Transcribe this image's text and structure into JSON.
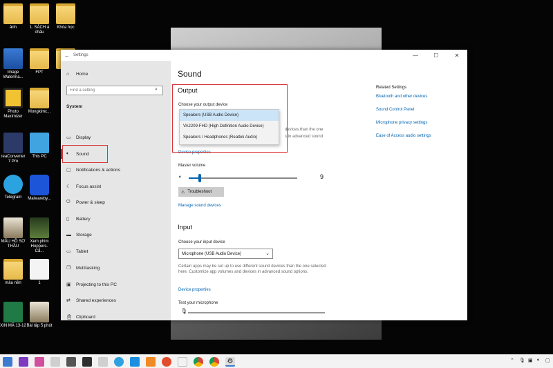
{
  "desktop": {
    "icons": [
      {
        "label": "ảnh"
      },
      {
        "label": "1. SÁCH á chấu"
      },
      {
        "label": "Khóa học"
      },
      {
        "label": "Image Waterma..."
      },
      {
        "label": "FPT"
      },
      {
        "label": ""
      },
      {
        "label": "Photo Maximizer"
      },
      {
        "label": "Mongkimc..."
      },
      {
        "label": "reaConverter 7 Pro"
      },
      {
        "label": "This PC"
      },
      {
        "label": "Telegram"
      },
      {
        "label": "Malwareby..."
      },
      {
        "label": "MẪU HỒ SƠ THẦU"
      },
      {
        "label": "Xem phim Hoppers- Cẩ..."
      },
      {
        "label": "màu nền"
      },
      {
        "label": "1"
      },
      {
        "label": "XIN MÃ 13-12"
      },
      {
        "label": "Bài tập 5 phút"
      }
    ]
  },
  "window": {
    "title": "Settings",
    "controls": {
      "minimize": "—",
      "maximize": "☐",
      "close": "✕"
    }
  },
  "sidebar": {
    "home": "Home",
    "search_placeholder": "Find a setting",
    "section": "System",
    "items": [
      {
        "label": "Display"
      },
      {
        "label": "Sound"
      },
      {
        "label": "Notifications & actions"
      },
      {
        "label": "Focus assist"
      },
      {
        "label": "Power & sleep"
      },
      {
        "label": "Battery"
      },
      {
        "label": "Storage"
      },
      {
        "label": "Tablet"
      },
      {
        "label": "Multitasking"
      },
      {
        "label": "Projecting to this PC"
      },
      {
        "label": "Shared experiences"
      },
      {
        "label": "Clipboard"
      }
    ]
  },
  "main": {
    "title": "Sound",
    "output": {
      "heading": "Output",
      "device_label": "Choose your output device",
      "options": [
        "Speakers (USB Audio Device)",
        "VA2209-FHD (High Definition Audio Device)",
        "Speakers / Headphones (Realtek Audio)"
      ],
      "hidden_text_1": "devices than the one",
      "hidden_text_2": "s in advanced sound",
      "device_properties": "Device properties",
      "volume_label": "Master volume",
      "volume_value": "9",
      "volume_level_percent": 10,
      "troubleshoot": "Troubleshoot",
      "manage_devices": "Manage sound devices"
    },
    "input": {
      "heading": "Input",
      "device_label": "Choose your input device",
      "selected_device": "Microphone (USB Audio Device)",
      "help_text": "Certain apps may be set up to use different sound devices than the one selected here. Customize app volumes and devices in advanced sound options.",
      "device_properties": "Device properties",
      "test_label": "Test your microphone"
    }
  },
  "related": {
    "heading": "Related Settings",
    "links": [
      "Bluetooth and other devices",
      "Sound Control Panel",
      "Microphone privacy settings",
      "Ease of Access audio settings"
    ]
  },
  "colors": {
    "accent": "#0063b1",
    "highlight_box": "#d93636",
    "sidebar_bg": "#e6e6e6"
  }
}
